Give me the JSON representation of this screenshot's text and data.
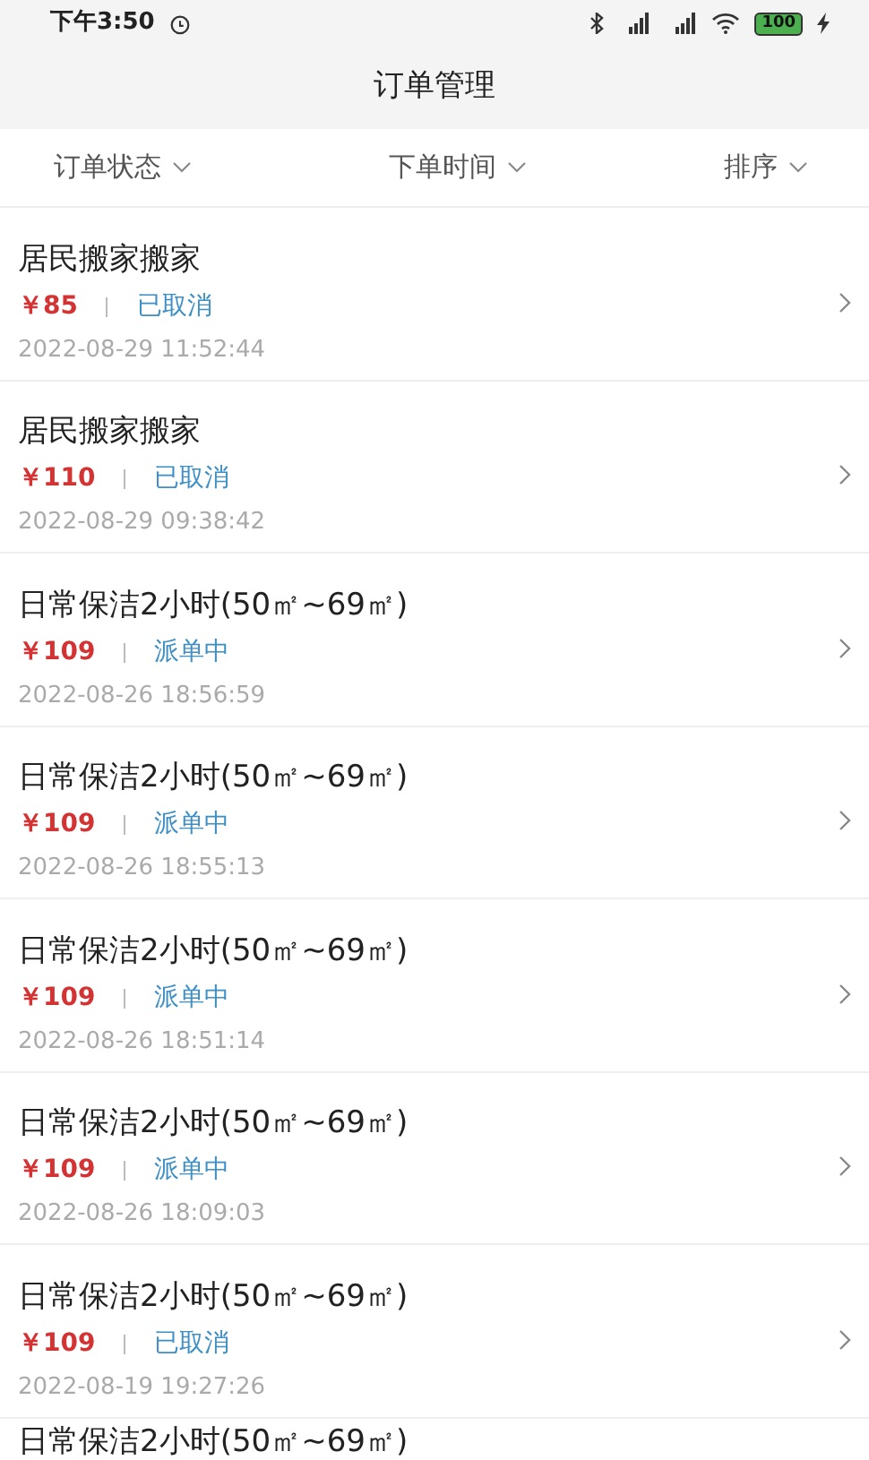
{
  "status_bar": {
    "time": "下午3:50",
    "battery": "100"
  },
  "header": {
    "title": "订单管理"
  },
  "filters": [
    {
      "label": "订单状态"
    },
    {
      "label": "下单时间"
    },
    {
      "label": "排序"
    }
  ],
  "orders": [
    {
      "title": "居民搬家搬家",
      "price": "￥85",
      "status": "已取消",
      "time": "2022-08-29 11:52:44"
    },
    {
      "title": "居民搬家搬家",
      "price": "￥110",
      "status": "已取消",
      "time": "2022-08-29 09:38:42"
    },
    {
      "title": "日常保洁2小时(50㎡~69㎡)",
      "price": "￥109",
      "status": "派单中",
      "time": "2022-08-26 18:56:59"
    },
    {
      "title": "日常保洁2小时(50㎡~69㎡)",
      "price": "￥109",
      "status": "派单中",
      "time": "2022-08-26 18:55:13"
    },
    {
      "title": "日常保洁2小时(50㎡~69㎡)",
      "price": "￥109",
      "status": "派单中",
      "time": "2022-08-26 18:51:14"
    },
    {
      "title": "日常保洁2小时(50㎡~69㎡)",
      "price": "￥109",
      "status": "派单中",
      "time": "2022-08-26 18:09:03"
    },
    {
      "title": "日常保洁2小时(50㎡~69㎡)",
      "price": "￥109",
      "status": "已取消",
      "time": "2022-08-19 19:27:26"
    },
    {
      "title": "日常保洁2小时(50㎡~69㎡)"
    }
  ]
}
